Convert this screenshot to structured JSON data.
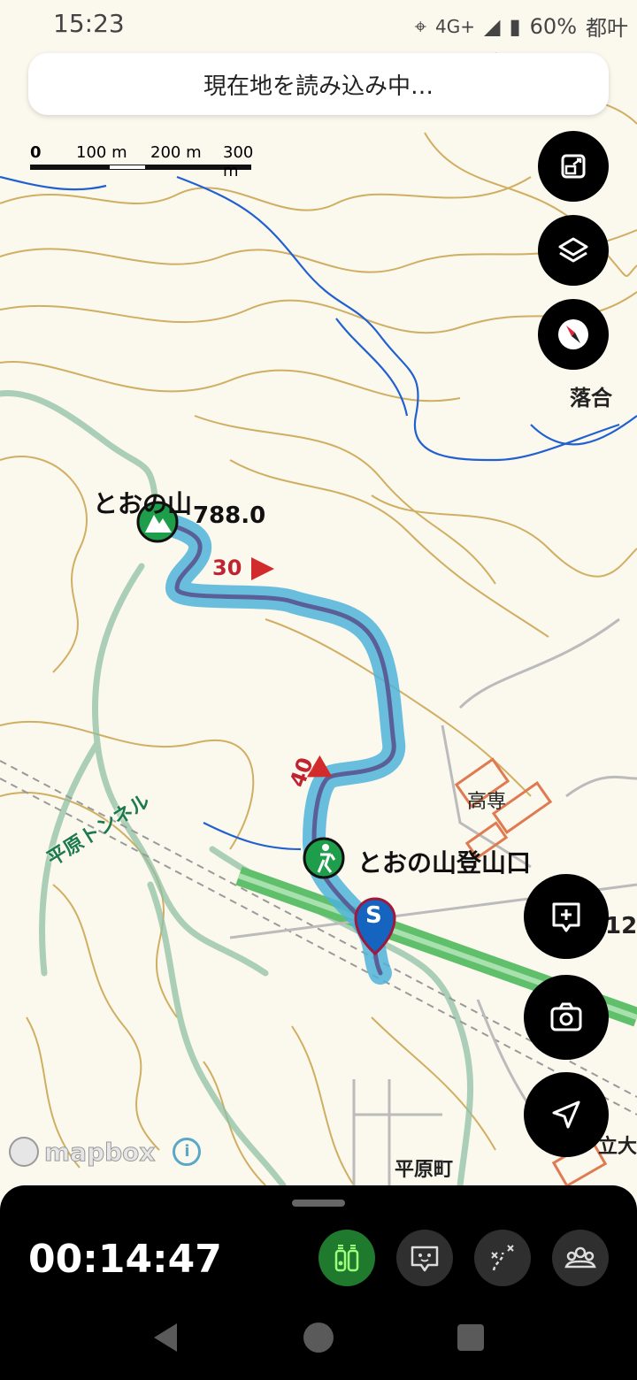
{
  "status_bar": {
    "time": "15:23",
    "network": "4G+",
    "battery": "60%",
    "edge_text": "都叶"
  },
  "banner": {
    "text": "現在地を読み込み中…"
  },
  "scale": {
    "zero": "0",
    "m100": "100 m",
    "m200": "200 m",
    "m300": "300 m"
  },
  "map": {
    "peak_name": "とおの山",
    "peak_elevation": "788.0",
    "trailhead_name": "とおの山登山口",
    "tunnel_name": "平原トンネル",
    "place_ochiai": "落合",
    "place_kosen": "高専",
    "place_hirahara": "平原町",
    "place_partial_right": "立大",
    "edge_number": "12",
    "route_marker_30": "30",
    "route_marker_40": "40",
    "start_marker": "S",
    "attribution": "mapbox"
  },
  "recording": {
    "elapsed": "00:14:47"
  },
  "colors": {
    "route": "#5b5f97",
    "route_halo": "#4fb3d9",
    "contour": "#c9a24a",
    "stream": "#2160d0",
    "road": "#5fbf6a"
  }
}
